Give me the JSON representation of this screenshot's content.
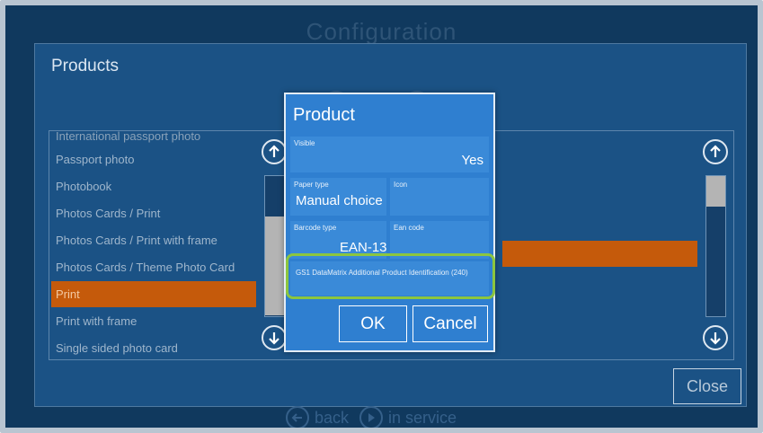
{
  "background": {
    "title": "Configuration",
    "panel_title": "Products",
    "list_items": [
      "International passport photo",
      "Passport photo",
      "Photobook",
      "Photos Cards / Print",
      "Photos Cards / Print with frame",
      "Photos Cards / Theme Photo Card",
      "Print",
      "Print with frame",
      "Single sided photo card"
    ],
    "selected_item": "Print",
    "close_label": "Close",
    "nav": {
      "back_label": "back",
      "in_service_label": "in service"
    }
  },
  "dialog": {
    "title": "Product",
    "visible": {
      "label": "Visible",
      "value": "Yes"
    },
    "paper_type": {
      "label": "Paper type",
      "value": "Manual choice"
    },
    "icon_field": {
      "label": "Icon",
      "value": ""
    },
    "barcode_type": {
      "label": "Barcode type",
      "value": "EAN-13"
    },
    "ean_code": {
      "label": "Ean code",
      "value": ""
    },
    "gs1": {
      "label": "GS1 DataMatrix Additional Product Identification (240)",
      "value": ""
    },
    "ok_label": "OK",
    "cancel_label": "Cancel"
  },
  "colors": {
    "accent_orange": "#c55a0b",
    "highlight_green": "#8cc63f",
    "dialog_blue": "#2f7fd0"
  },
  "icons": [
    "arrow-up-icon",
    "arrow-down-icon",
    "back-arrow-icon",
    "play-icon"
  ]
}
